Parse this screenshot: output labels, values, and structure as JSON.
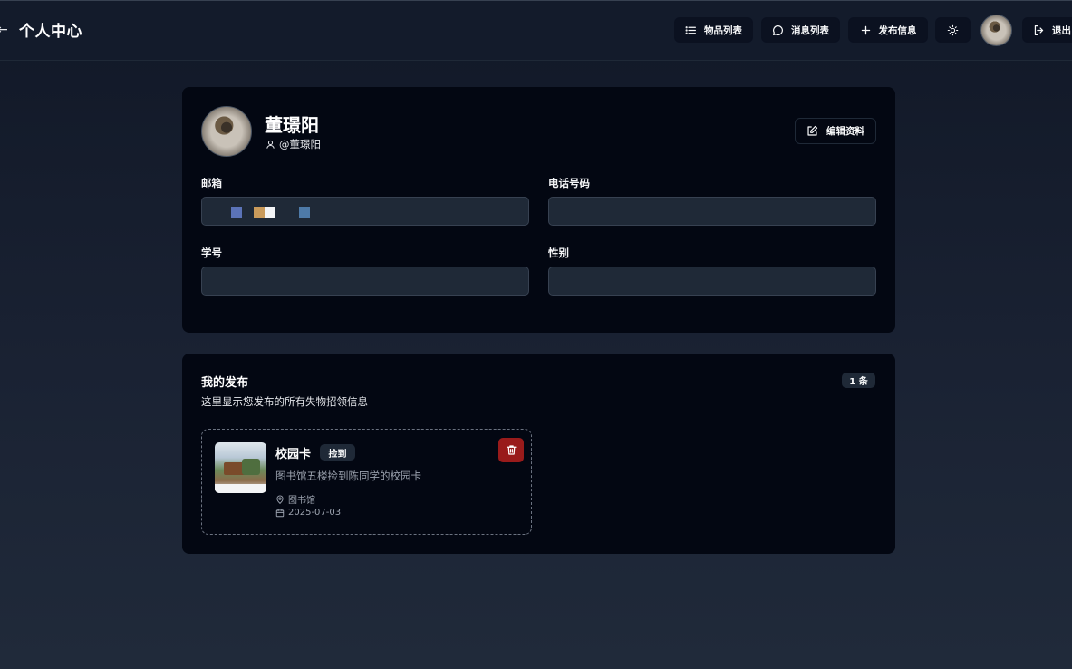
{
  "header": {
    "back_glyph": "←",
    "title": "个人中心",
    "nav": {
      "items_label": "物品列表",
      "messages_label": "消息列表",
      "publish_label": "发布信息",
      "logout_label": "退出"
    }
  },
  "profile": {
    "name": "董璟阳",
    "username": "@董璟阳",
    "edit_label": "编辑资料",
    "fields": {
      "email_label": "邮箱",
      "phone_label": "电话号码",
      "student_id_label": "学号",
      "gender_label": "性别"
    }
  },
  "posts": {
    "title": "我的发布",
    "subtitle": "这里显示您发布的所有失物招领信息",
    "count_badge": "1 条",
    "items": [
      {
        "title": "校园卡",
        "tag": "捡到",
        "description": "图书馆五楼捡到陈同学的校园卡",
        "location": "图书馆",
        "date": "2025-07-03"
      }
    ]
  },
  "icons": [
    "list-icon",
    "message-icon",
    "plus-icon",
    "sun-icon",
    "logout-icon",
    "user-icon",
    "edit-icon",
    "trash-icon",
    "map-pin-icon",
    "calendar-icon"
  ],
  "colors": {
    "card_bg": "#030712",
    "input_bg": "#1f2937",
    "delete_red": "#991b1b"
  }
}
